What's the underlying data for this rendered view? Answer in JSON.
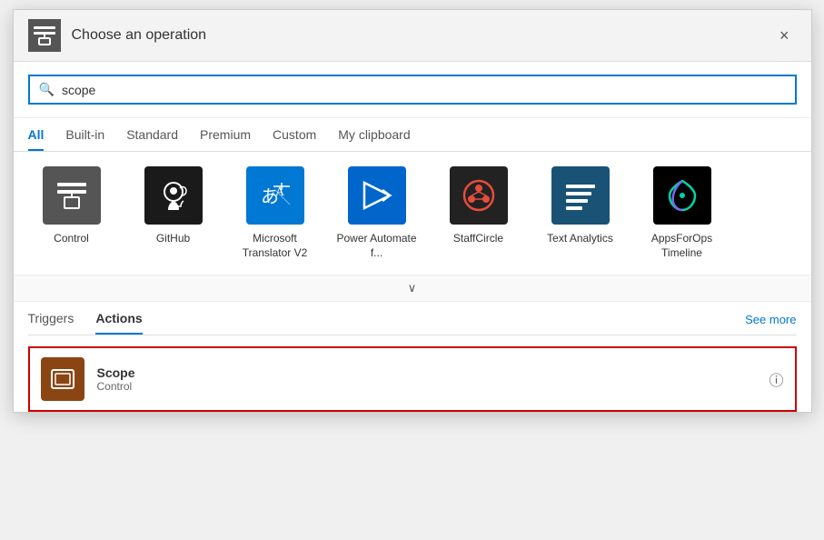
{
  "dialog": {
    "title": "Choose an operation",
    "close_label": "×"
  },
  "search": {
    "placeholder": "scope",
    "value": "scope",
    "icon": "🔍"
  },
  "tabs": [
    {
      "label": "All",
      "active": true
    },
    {
      "label": "Built-in",
      "active": false
    },
    {
      "label": "Standard",
      "active": false
    },
    {
      "label": "Premium",
      "active": false
    },
    {
      "label": "Custom",
      "active": false
    },
    {
      "label": "My clipboard",
      "active": false
    }
  ],
  "connectors": [
    {
      "label": "Control",
      "icon_type": "control"
    },
    {
      "label": "GitHub",
      "icon_type": "github"
    },
    {
      "label": "Microsoft Translator V2",
      "icon_type": "mstranslator"
    },
    {
      "label": "Power Automate f...",
      "icon_type": "powerautomate"
    },
    {
      "label": "StaffCircle",
      "icon_type": "staffcircle"
    },
    {
      "label": "Text Analytics",
      "icon_type": "textanalytics"
    },
    {
      "label": "AppsForOps Timeline",
      "icon_type": "appsforops"
    }
  ],
  "expand_icon": "∨",
  "sub_tabs": [
    {
      "label": "Triggers",
      "active": false
    },
    {
      "label": "Actions",
      "active": true
    }
  ],
  "see_more_label": "See more",
  "result": {
    "title": "Scope",
    "subtitle": "Control",
    "info_icon": "ⓘ"
  }
}
